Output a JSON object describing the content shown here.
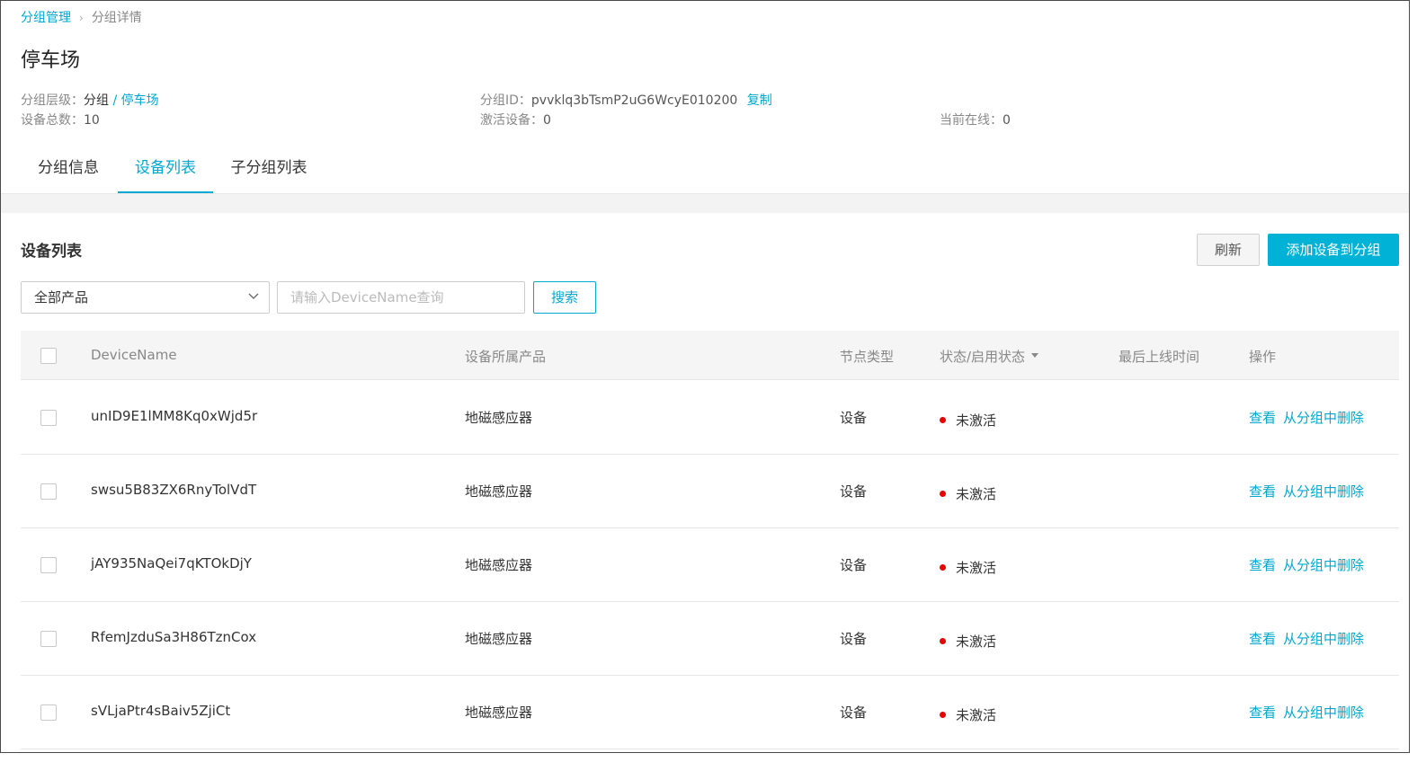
{
  "breadcrumb": {
    "parent": "分组管理",
    "current": "分组详情"
  },
  "page_title": "停车场",
  "meta": {
    "level_label": "分组层级：",
    "level_root": "分组",
    "level_child": "/ 停车场",
    "group_id_label": "分组ID：",
    "group_id": "pvvklq3bTsmP2uG6WcyE010200",
    "copy_label": "复制",
    "total_label": "设备总数：",
    "total_value": "10",
    "activated_label": "激活设备：",
    "activated_value": "0",
    "online_label": "当前在线：",
    "online_value": "0"
  },
  "tabs": [
    {
      "label": "分组信息",
      "active": false
    },
    {
      "label": "设备列表",
      "active": true
    },
    {
      "label": "子分组列表",
      "active": false
    }
  ],
  "section": {
    "title": "设备列表",
    "refresh_label": "刷新",
    "add_label": "添加设备到分组"
  },
  "filter": {
    "product_selected": "全部产品",
    "search_placeholder": "请输入DeviceName查询",
    "search_button": "搜索"
  },
  "table": {
    "columns": [
      "DeviceName",
      "设备所属产品",
      "节点类型",
      "状态/启用状态",
      "最后上线时间",
      "操作"
    ],
    "rows": [
      {
        "name": "unID9E1lMM8Kq0xWjd5r",
        "product": "地磁感应器",
        "node_type": "设备",
        "status": "未激活",
        "last_online": "",
        "view": "查看",
        "remove": "从分组中删除"
      },
      {
        "name": "swsu5B83ZX6RnyTolVdT",
        "product": "地磁感应器",
        "node_type": "设备",
        "status": "未激活",
        "last_online": "",
        "view": "查看",
        "remove": "从分组中删除"
      },
      {
        "name": "jAY935NaQei7qKTOkDjY",
        "product": "地磁感应器",
        "node_type": "设备",
        "status": "未激活",
        "last_online": "",
        "view": "查看",
        "remove": "从分组中删除"
      },
      {
        "name": "RfemJzduSa3H86TznCox",
        "product": "地磁感应器",
        "node_type": "设备",
        "status": "未激活",
        "last_online": "",
        "view": "查看",
        "remove": "从分组中删除"
      },
      {
        "name": "sVLjaPtr4sBaiv5ZjiCt",
        "product": "地磁感应器",
        "node_type": "设备",
        "status": "未激活",
        "last_online": "",
        "view": "查看",
        "remove": "从分组中删除"
      }
    ]
  },
  "colors": {
    "accent": "#00a8d0",
    "primary_button": "#00b2d6",
    "status_inactive": "#e60000"
  },
  "icons": {
    "breadcrumb_separator": "chevron-right-icon",
    "select_arrow": "chevron-down-icon",
    "status": "status-dot-icon",
    "sort": "sort-caret-icon"
  }
}
